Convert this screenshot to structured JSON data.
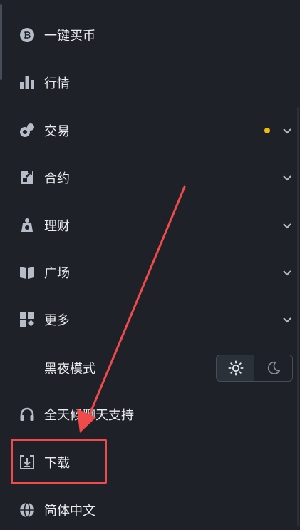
{
  "menu": {
    "items": [
      {
        "label": "一键买币",
        "icon": "bitcoin-icon",
        "chevron": false
      },
      {
        "label": "行情",
        "icon": "bar-chart-icon",
        "chevron": false
      },
      {
        "label": "交易",
        "icon": "trade-icon",
        "chevron": true,
        "badge_dot": true
      },
      {
        "label": "合约",
        "icon": "futures-icon",
        "chevron": true
      },
      {
        "label": "理财",
        "icon": "earn-icon",
        "chevron": true
      },
      {
        "label": "广场",
        "icon": "book-icon",
        "chevron": true
      },
      {
        "label": "更多",
        "icon": "grid-icon",
        "chevron": true
      },
      {
        "label": "黑夜模式",
        "icon": "none",
        "chevron": false
      },
      {
        "label": "全天候聊天支持",
        "icon": "headset-icon",
        "chevron": false
      },
      {
        "label": "下载",
        "icon": "download-icon",
        "chevron": false,
        "highlighted": true
      },
      {
        "label": "简体中文",
        "icon": "globe-icon",
        "chevron": false
      }
    ]
  },
  "theme_toggle": {
    "options": [
      "sun-icon",
      "moon-icon"
    ],
    "active": "sun-icon"
  },
  "colors": {
    "background": "#1f2129",
    "text": "#eaecef",
    "icon": "#b7bdc6",
    "dot": "#f0b90b",
    "annotation": "#f04a4a"
  }
}
